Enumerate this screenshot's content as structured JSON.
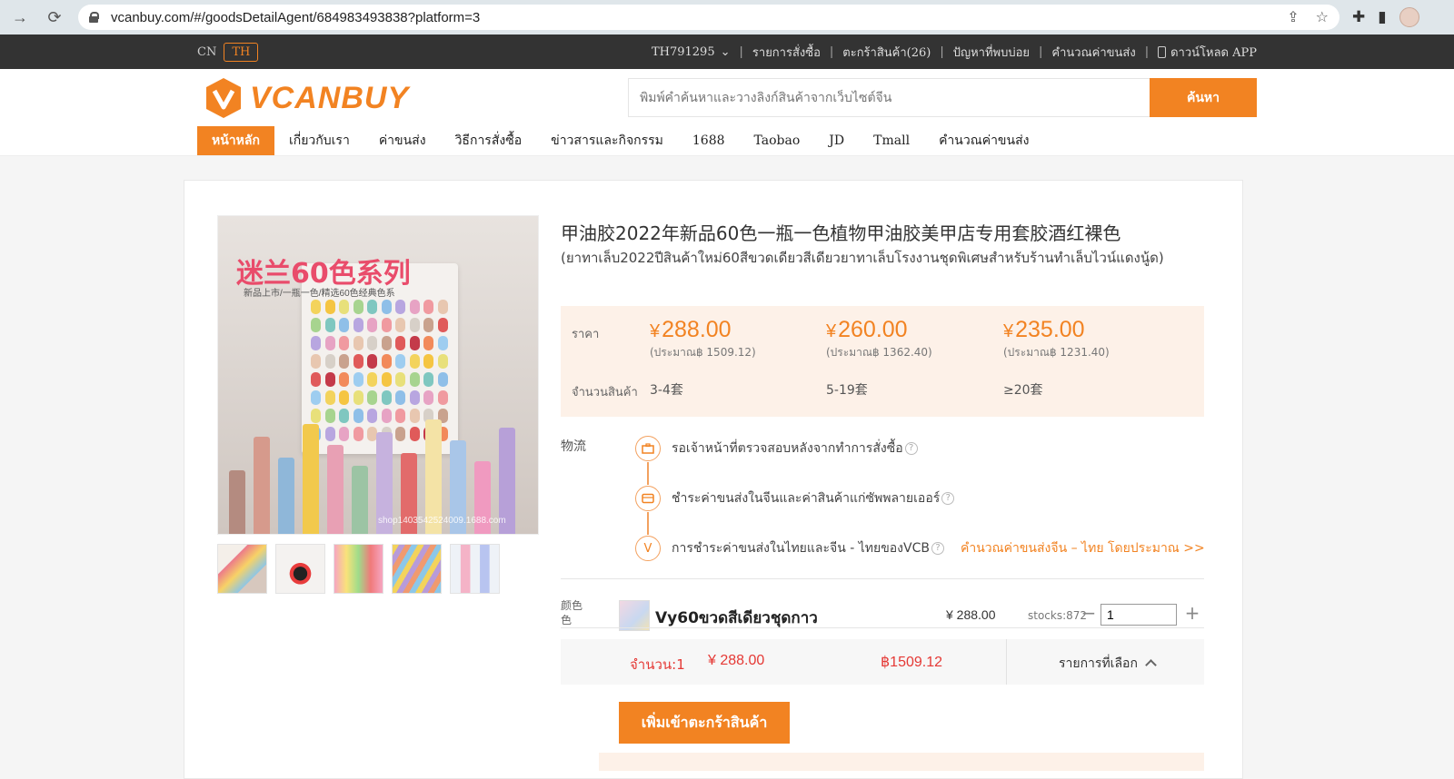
{
  "browser": {
    "url": "vcanbuy.com/#/goodsDetailAgent/684983493838?platform=3"
  },
  "topbar": {
    "lang_cn": "CN",
    "lang_th": "TH",
    "account": "TH791295",
    "orders": "รายการสั่งซื้อ",
    "cart": "ตะกร้าสินค้า(26)",
    "faq": "ปัญหาที่พบบ่อย",
    "shipping_calc": "คำนวณค่าขนส่ง",
    "download_app": "ดาวน์โหลด APP"
  },
  "header": {
    "logo_text": "VCANBUY",
    "search_placeholder": "พิมพ์คำค้นหาและวางลิงก์สินค้าจากเว็บไซต์จีน",
    "search_button": "ค้นหา",
    "nav": [
      "หน้าหลัก",
      "เกี่ยวกับเรา",
      "ค่าขนส่ง",
      "วิธีการสั่งซื้อ",
      "ข่าวสารและกิจกรรม",
      "1688",
      "Taobao",
      "JD",
      "Tmall",
      "คำนวณค่าขนส่ง"
    ]
  },
  "gallery": {
    "promo_text": "迷兰60色系列",
    "promo_sub": "新品上市/一瓶一色/精选60色经典色系",
    "watermark": "shop1403542524009.1688.com"
  },
  "product": {
    "title": "甲油胶2022年新品60色一瓶一色植物甲油胶美甲店专用套胶酒红裸色",
    "subtitle": "(ยาทาเล็บ2022ปีสินค้าใหม่60สีขวดเดียวสีเดียวยาทาเล็บโรงงานชุดพิเศษสำหรับร้านทำเล็บไวน์แดงนู้ด)",
    "price_label": "ราคา",
    "qty_label": "จำนวนสินค้า",
    "tiers": [
      {
        "price": "288.00",
        "approx": "(ประมาณ฿ 1509.12)",
        "qty": "3-4套"
      },
      {
        "price": "260.00",
        "approx": "(ประมาณ฿ 1362.40)",
        "qty": "5-19套"
      },
      {
        "price": "235.00",
        "approx": "(ประมาณ฿ 1231.40)",
        "qty": "≥20套"
      }
    ],
    "yen_symbol": "¥"
  },
  "logistics": {
    "label": "物流",
    "steps": [
      {
        "text": "รอเจ้าหน้าที่ตรวจสอบหลังจากทำการสั่งซื้อ",
        "icon": "briefcase-icon"
      },
      {
        "text": "ชำระค่าขนส่งในจีนและค่าสินค้าแก่ซัพพลายเออร์",
        "icon": "wallet-icon"
      },
      {
        "text": "การชำระค่าขนส่งในไทยและจีน - ไทยของVCB",
        "icon": "v-icon"
      }
    ],
    "calc_link": "คำนวณค่าขนส่งจีน – ไทย โดยประมาณ >>",
    "help": "?"
  },
  "variant": {
    "label": "颜色 色",
    "name": "Vy60ขวดสีเดียวชุดกาว",
    "price": "¥ 288.00",
    "stock": "stocks:872",
    "quantity": "1"
  },
  "summary": {
    "qty": "จำนวน:1",
    "yen_total": "¥ 288.00",
    "thb_total": "฿1509.12",
    "selected": "รายการที่เลือก"
  },
  "actions": {
    "add_to_cart": "เพิ่มเข้าตะกร้าสินค้า"
  },
  "colors": {
    "accent": "#f28322",
    "price_red": "#e53935",
    "topbar": "#333333"
  }
}
